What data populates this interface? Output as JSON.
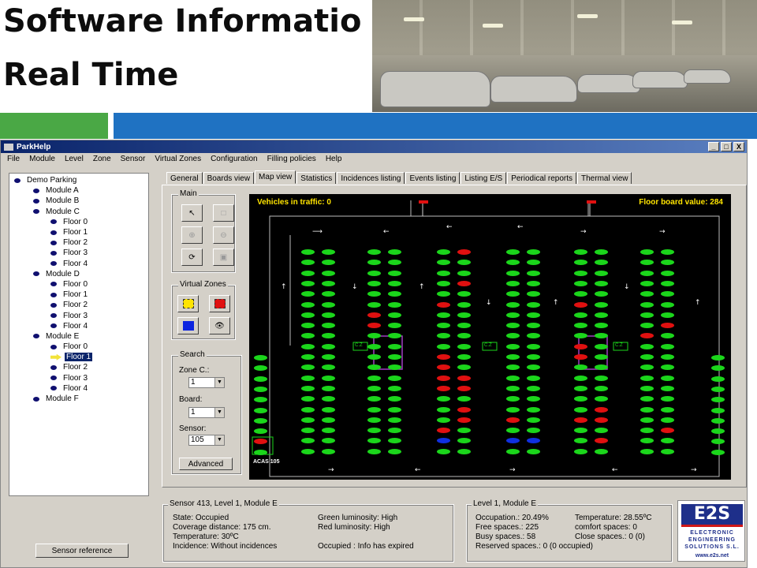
{
  "slide": {
    "title_line1": "Software Informatio",
    "title_line2": "Real Time"
  },
  "window": {
    "title": "ParkHelp",
    "menu": [
      "File",
      "Module",
      "Level",
      "Zone",
      "Sensor",
      "Virtual Zones",
      "Configuration",
      "Filling policies",
      "Help"
    ],
    "controls": [
      "_",
      "□",
      "X"
    ]
  },
  "tree": [
    {
      "label": "Demo Parking",
      "level": 0
    },
    {
      "label": "Module A",
      "level": 1
    },
    {
      "label": "Module B",
      "level": 1
    },
    {
      "label": "Module C",
      "level": 1
    },
    {
      "label": "Floor 0",
      "level": 2
    },
    {
      "label": "Floor 1",
      "level": 2
    },
    {
      "label": "Floor 2",
      "level": 2
    },
    {
      "label": "Floor 3",
      "level": 2
    },
    {
      "label": "Floor 4",
      "level": 2
    },
    {
      "label": "Module D",
      "level": 1
    },
    {
      "label": "Floor 0",
      "level": 2
    },
    {
      "label": "Floor 1",
      "level": 2
    },
    {
      "label": "Floor 2",
      "level": 2
    },
    {
      "label": "Floor 3",
      "level": 2
    },
    {
      "label": "Floor 4",
      "level": 2
    },
    {
      "label": "Module E",
      "level": 1
    },
    {
      "label": "Floor 0",
      "level": 2
    },
    {
      "label": "Floor 1",
      "level": 2,
      "selected": true
    },
    {
      "label": "Floor 2",
      "level": 2
    },
    {
      "label": "Floor 3",
      "level": 2
    },
    {
      "label": "Floor 4",
      "level": 2
    },
    {
      "label": "Module F",
      "level": 1
    }
  ],
  "sensor_reference_label": "Sensor reference",
  "tabs": [
    "General",
    "Boards view",
    "Map view",
    "Statistics",
    "Incidences listing",
    "Events listing",
    "Listing E/S",
    "Periodical reports",
    "Thermal view"
  ],
  "active_tab": "Map view",
  "tools": {
    "main_label": "Main",
    "virtual_zones_label": "Virtual Zones"
  },
  "search": {
    "label": "Search",
    "zone_label": "Zone C.:",
    "zone_value": "1",
    "board_label": "Board:",
    "board_value": "1",
    "sensor_label": "Sensor:",
    "sensor_value": "105",
    "advanced_label": "Advanced"
  },
  "map": {
    "vehicles_label": "Vehicles in traffic: 0",
    "floor_board_label": "Floor board value: 284",
    "zone_tag": "C.Z",
    "exit_tag": "ACAS 105",
    "colors": {
      "free": "#1bd61b",
      "busy": "#e01010",
      "reserved": "#1030e0",
      "reference": "#ffffff"
    },
    "columns": [
      {
        "cells": "GGGGGGGGGGGGGGGGGGGG"
      },
      {
        "cells": "GGGGGGGGGGGGGGGGGGGG"
      },
      {
        "cells": "GGGGGGRRGGGGGGGGGGGG"
      },
      {
        "cells": "GGGGGGGGGGGGGGGGGGGG"
      },
      {
        "cells": "GGGGGRGGGGRRRRGGGRBG"
      },
      {
        "cells": "RGGRGGGGGGGGRRGRRGGG"
      },
      {
        "cells": "GGGGGGGGGGGGGGGGRGBG"
      },
      {
        "cells": "GGGGGGGGGGGGGGGGGGBG"
      },
      {
        "cells": "GGGGGRGGGRRGGGGGRGGG"
      },
      {
        "cells": "GGGGGGGGGGGGGGGRRGRG"
      },
      {
        "cells": "GGGGGGGGRGGGGGGGGGGG"
      },
      {
        "cells": "GGGGGGGRGGGGGGGGGRGG"
      }
    ]
  },
  "sensor_info": {
    "header": "Sensor 413, Level 1, Module E",
    "left": [
      "State: Occupied",
      "Coverage distance: 175 cm.",
      "Temperature: 30ºC",
      "Incidence: Without incidences"
    ],
    "right": [
      "Green luminosity: High",
      "Red luminosity: High",
      "",
      "Occupied : Info has expired"
    ]
  },
  "level_info": {
    "header": "Level 1, Module E",
    "left": [
      "Occupation.: 20.49%",
      "Free spaces.: 225",
      "Busy spaces.: 58",
      "Reserved spaces.: 0 (0 occupied)"
    ],
    "right": [
      "Temperature: 28.55ºC",
      "comfort spaces: 0",
      "Close spaces.: 0 (0)",
      ""
    ]
  },
  "logo": {
    "name": "E2S",
    "line1": "ELECTRONIC",
    "line2": "ENGINEERING",
    "line3": "SOLUTIONS S.L.",
    "url": "www.e2s.net"
  }
}
